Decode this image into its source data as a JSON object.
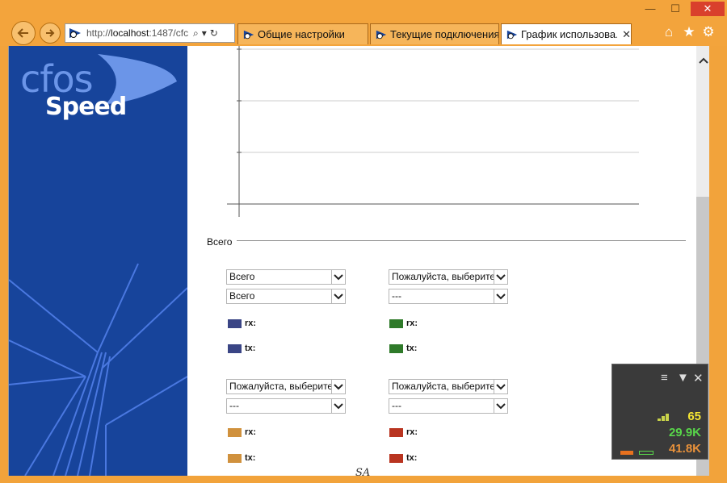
{
  "window": {
    "min": "—",
    "max": "☐",
    "close": "✕"
  },
  "address": {
    "url_prefix": "http://",
    "url_host": "localhost",
    "url_rest": ":1487/cfc"
  },
  "tabs": [
    {
      "label": "Общие настройки",
      "active": false
    },
    {
      "label": "Текущие подключения",
      "active": false
    },
    {
      "label": "График использова...",
      "active": true,
      "close": "✕"
    }
  ],
  "logo": {
    "line1": "cfos",
    "line2": "Speed"
  },
  "section": {
    "title": "Всего"
  },
  "selects": {
    "g1_a": "Всего",
    "g1_b": "Всего",
    "g2_a": "Пожалуйста, выберите",
    "g2_b": "---",
    "g3_a": "Пожалуйста, выберите",
    "g3_b": "---",
    "g4_a": "Пожалуйста, выберите",
    "g4_b": "---"
  },
  "legends": {
    "rx": "rx:",
    "tx": "tx:"
  },
  "colors": {
    "g1_rx": "#3a4585",
    "g1_tx": "#3a4585",
    "g2_rx": "#2f7a2a",
    "g2_tx": "#2f7a2a",
    "g3_rx": "#d0913d",
    "g3_tx": "#d0913d",
    "g4_rx": "#b93420",
    "g4_tx": "#b93420"
  },
  "widget": {
    "ping": "65",
    "rx": "29.9K",
    "tx": "41.8K"
  },
  "status": {
    "badge": "SA"
  }
}
